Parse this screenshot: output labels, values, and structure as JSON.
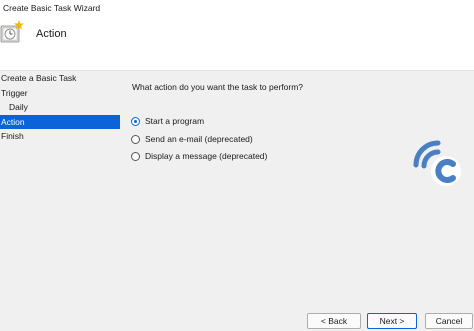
{
  "window": {
    "title": "Create Basic Task Wizard"
  },
  "header": {
    "title": "Action"
  },
  "sidebar": {
    "items": [
      {
        "label": "Create a Basic Task"
      },
      {
        "label": "Trigger"
      },
      {
        "label": "Daily"
      },
      {
        "label": "Action"
      },
      {
        "label": "Finish"
      }
    ],
    "selected": "Action"
  },
  "main": {
    "question": "What action do you want the task to perform?",
    "options": [
      {
        "label": "Start a program",
        "checked": true
      },
      {
        "label": "Send an e-mail (deprecated)",
        "checked": false
      },
      {
        "label": "Display a message (deprecated)",
        "checked": false
      }
    ]
  },
  "buttons": {
    "back": "< Back",
    "next": "Next >",
    "cancel": "Cancel"
  },
  "colors": {
    "accent": "#0a64d8",
    "panel": "#f0f0f0",
    "watermark": "#4a7fc4"
  },
  "icons": {
    "wizard": "clock-icon",
    "watermark": "logo-icon"
  }
}
